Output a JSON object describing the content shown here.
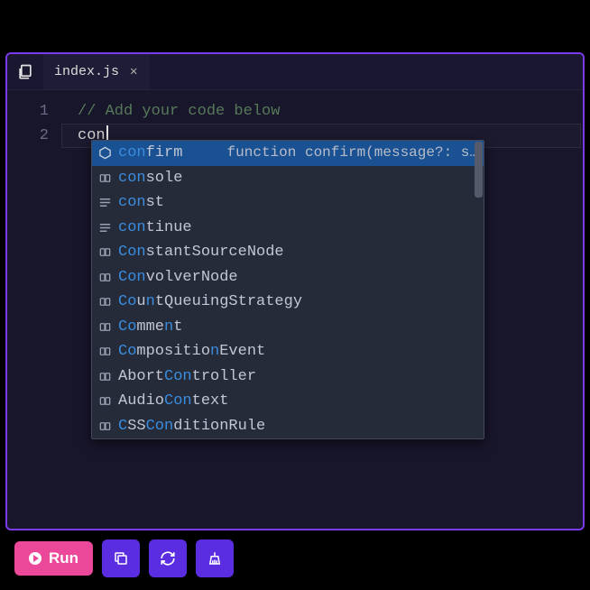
{
  "tab": {
    "filename": "index.js"
  },
  "editor": {
    "lines": {
      "1": {
        "num": "1",
        "text": "// Add your code below"
      },
      "2": {
        "num": "2",
        "text": "con"
      }
    }
  },
  "autocomplete": {
    "hint": "function confirm(message?: s…",
    "items": [
      {
        "kind": "func",
        "parts": [
          "con",
          "firm"
        ],
        "hl_index": 0
      },
      {
        "kind": "var",
        "parts": [
          "con",
          "sole"
        ],
        "hl_index": 0
      },
      {
        "kind": "kw",
        "parts": [
          "con",
          "st"
        ],
        "hl_index": 0
      },
      {
        "kind": "kw",
        "parts": [
          "con",
          "tinue"
        ],
        "hl_index": 0
      },
      {
        "kind": "var",
        "parts": [
          "Con",
          "stantSourceNode"
        ],
        "hl_index": 0
      },
      {
        "kind": "var",
        "parts": [
          "Con",
          "volverNode"
        ],
        "hl_index": 0
      },
      {
        "kind": "var",
        "parts": [
          "Co",
          "u",
          "n",
          "tQueuingStrategy"
        ],
        "hl_index": -1,
        "hl_set": [
          0,
          2
        ]
      },
      {
        "kind": "var",
        "parts": [
          "Co",
          "mme",
          "n",
          "t"
        ],
        "hl_index": -1,
        "hl_set": [
          0,
          2
        ]
      },
      {
        "kind": "var",
        "parts": [
          "Co",
          "mpositio",
          "n",
          "Event"
        ],
        "hl_index": -1,
        "hl_set": [
          0,
          2
        ]
      },
      {
        "kind": "var",
        "parts": [
          "Abort",
          "Con",
          "troller"
        ],
        "hl_index": 1
      },
      {
        "kind": "var",
        "parts": [
          "Audio",
          "Con",
          "text"
        ],
        "hl_index": 1
      },
      {
        "kind": "var",
        "parts": [
          "C",
          "SS",
          "Con",
          "ditionRule"
        ],
        "hl_index": -1,
        "hl_set": [
          0,
          2
        ]
      }
    ]
  },
  "toolbar": {
    "run_label": "Run"
  },
  "colors": {
    "accent": "#7c3aed",
    "run": "#ec4899",
    "highlight": "#3a8dde"
  }
}
